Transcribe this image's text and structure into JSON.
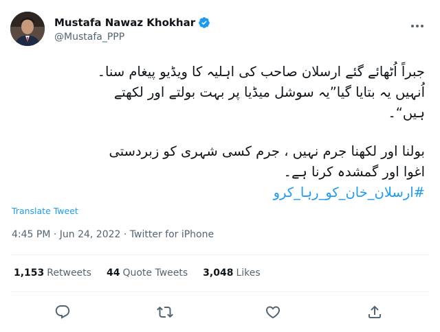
{
  "author": {
    "name": "Mustafa Nawaz Khokhar",
    "handle": "@Mustafa_PPP"
  },
  "tweet": {
    "paragraph1": [
      "جبراً اُٹھائے گئے ارسلان صاحب کی اہلیہ کا ویڈیو پیغام سنا۔",
      "اُنہیں یہ بتایا گیا”یہ سوشل میڈیا پر بہت بولتے اور لکھتے",
      "ہیں“۔"
    ],
    "paragraph2": [
      "بولنا اور لکھنا جرم نہیں ، جرم کسی شہری کو زبردستی",
      "اغوا اور گمشدہ کرنا ہے۔"
    ],
    "hashtag": "#ارسلان_خان_کو_رہا_کرو",
    "translate_label": "Translate Tweet",
    "timestamp": "4:45 PM · Jun 24, 2022 · Twitter for iPhone"
  },
  "stats": {
    "retweets_count": "1,153",
    "retweets_label": "Retweets",
    "quotes_count": "44",
    "quotes_label": "Quote Tweets",
    "likes_count": "3,048",
    "likes_label": "Likes"
  },
  "icons": {
    "verified": "verified-badge-icon",
    "more": "more-options-icon",
    "reply": "reply-icon",
    "retweet": "retweet-icon",
    "like": "like-icon",
    "share": "share-icon"
  },
  "colors": {
    "accent": "#1d9bf0",
    "secondary_text": "#536471",
    "divider": "#eff3f4"
  }
}
